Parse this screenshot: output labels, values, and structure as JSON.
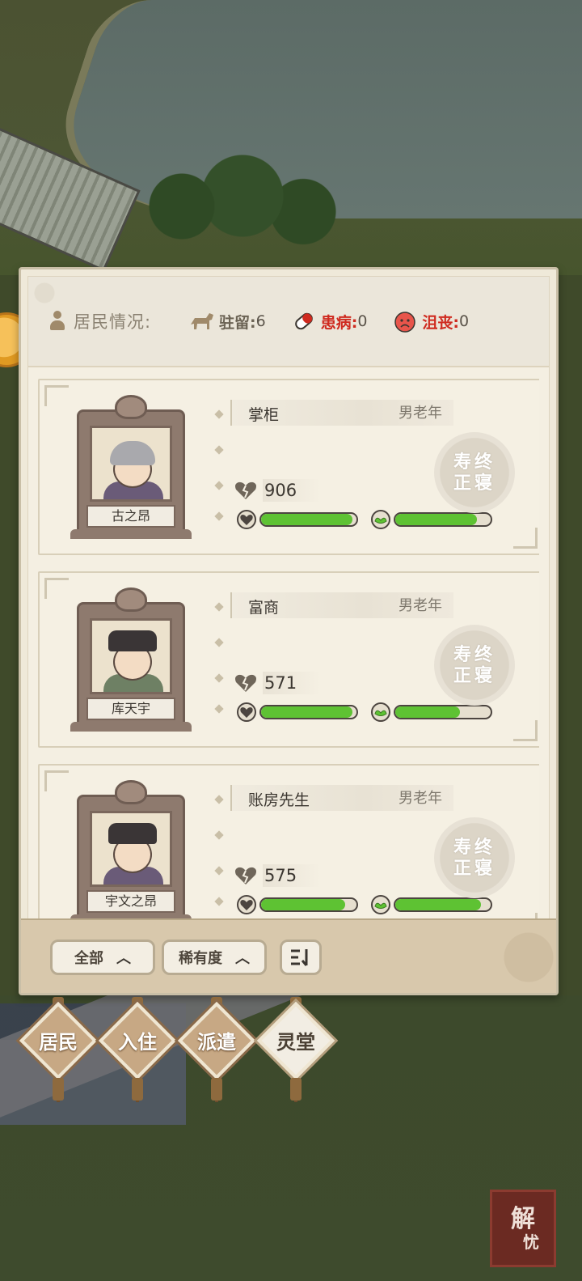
{
  "status": {
    "label": "居民情况:",
    "stationed_label": "驻留:",
    "stationed_value": "6",
    "sick_label": "患病:",
    "sick_value": "0",
    "depressed_label": "沮丧:",
    "depressed_value": "0"
  },
  "residents": [
    {
      "name": "古之昂",
      "role": "掌柜",
      "tag": "男老年",
      "value": "906",
      "health": 0.96,
      "mood": 0.86,
      "status_seal": [
        "寿终",
        "正寝"
      ],
      "hair": "grey",
      "robe": "purple"
    },
    {
      "name": "库天宇",
      "role": "富商",
      "tag": "男老年",
      "value": "571",
      "health": 0.96,
      "mood": 0.68,
      "status_seal": [
        "寿终",
        "正寝"
      ],
      "hair": "hat",
      "robe": "green"
    },
    {
      "name": "宇文之昂",
      "role": "账房先生",
      "tag": "男老年",
      "value": "575",
      "health": 0.88,
      "mood": 0.9,
      "status_seal": [
        "寿终",
        "正寝"
      ],
      "hair": "hat",
      "robe": "purple"
    }
  ],
  "filters": {
    "all_label": "全部",
    "rarity_label": "稀有度",
    "sort_label": "三",
    "chevron": "^"
  },
  "nav": {
    "tabs": [
      {
        "label": "居民",
        "active": false
      },
      {
        "label": "入住",
        "active": false
      },
      {
        "label": "派遣",
        "active": false
      },
      {
        "label": "灵堂",
        "active": true
      }
    ]
  },
  "stamp": {
    "line1": "解",
    "line2": "忧"
  },
  "colors": {
    "bar_fill": "#5ec233",
    "sick_red": "#cf2a1f",
    "panel_bg": "#efe9d9"
  }
}
